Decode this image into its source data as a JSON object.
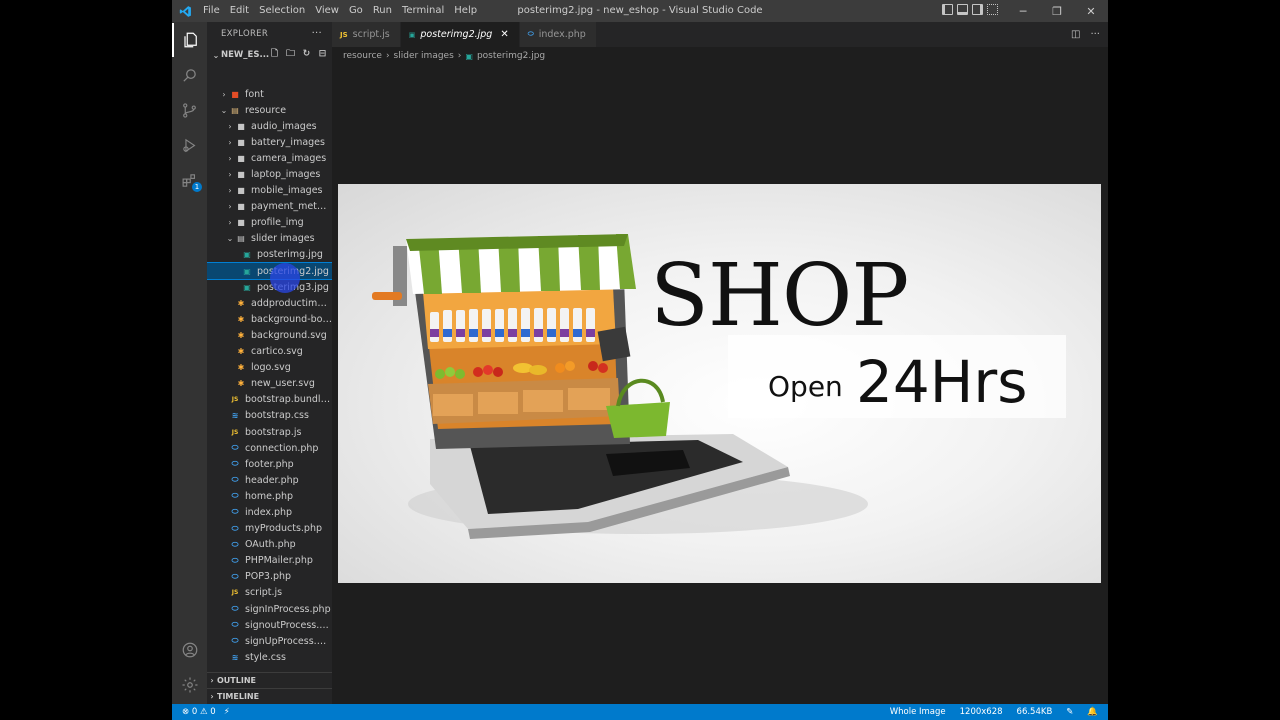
{
  "window": {
    "title": "posterimg2.jpg - new_eshop - Visual Studio Code",
    "menu": [
      "File",
      "Edit",
      "Selection",
      "View",
      "Go",
      "Run",
      "Terminal",
      "Help"
    ],
    "controls": [
      "─",
      "❐",
      "✕"
    ]
  },
  "activity": {
    "extensions_badge": "1"
  },
  "sidebar": {
    "title": "EXPLORER",
    "more": "···",
    "project": "NEW_ES...",
    "tree": [
      {
        "label": "font",
        "type": "folder",
        "depth": 1,
        "open": false,
        "icon_color": "#e44d26"
      },
      {
        "label": "resource",
        "type": "folder",
        "depth": 1,
        "open": true,
        "icon_color": "#dcb67a"
      },
      {
        "label": "audio_images",
        "type": "folder",
        "depth": 2,
        "open": false,
        "icon_color": "#c5c5c5"
      },
      {
        "label": "battery_images",
        "type": "folder",
        "depth": 2,
        "open": false,
        "icon_color": "#c5c5c5"
      },
      {
        "label": "camera_images",
        "type": "folder",
        "depth": 2,
        "open": false,
        "icon_color": "#c5c5c5"
      },
      {
        "label": "laptop_images",
        "type": "folder",
        "depth": 2,
        "open": false,
        "icon_color": "#c5c5c5"
      },
      {
        "label": "mobile_images",
        "type": "folder",
        "depth": 2,
        "open": false,
        "icon_color": "#c5c5c5"
      },
      {
        "label": "payment_method",
        "type": "folder",
        "depth": 2,
        "open": false,
        "icon_color": "#c5c5c5"
      },
      {
        "label": "profile_img",
        "type": "folder",
        "depth": 2,
        "open": false,
        "icon_color": "#c5c5c5"
      },
      {
        "label": "slider images",
        "type": "folder",
        "depth": 2,
        "open": true,
        "icon_color": "#c5c5c5"
      },
      {
        "label": "posterimg.jpg",
        "type": "image",
        "depth": 3,
        "icon_color": "#26a69a"
      },
      {
        "label": "posterimg2.jpg",
        "type": "image",
        "depth": 3,
        "selected": true,
        "icon_color": "#26a69a"
      },
      {
        "label": "posterimg3.jpg",
        "type": "image",
        "depth": 3,
        "icon_color": "#26a69a"
      },
      {
        "label": "addproductimg....",
        "type": "svg",
        "depth": 2,
        "icon_color": "#ffb13b"
      },
      {
        "label": "background-bod...",
        "type": "svg",
        "depth": 2,
        "icon_color": "#ffb13b"
      },
      {
        "label": "background.svg",
        "type": "svg",
        "depth": 2,
        "icon_color": "#ffb13b"
      },
      {
        "label": "cartico.svg",
        "type": "svg",
        "depth": 2,
        "icon_color": "#ffb13b"
      },
      {
        "label": "logo.svg",
        "type": "svg",
        "depth": 2,
        "icon_color": "#ffb13b"
      },
      {
        "label": "new_user.svg",
        "type": "svg",
        "depth": 2,
        "icon_color": "#ffb13b"
      },
      {
        "label": "bootstrap.bundle.js",
        "type": "js",
        "depth": 1,
        "icon_color": "#f1c232"
      },
      {
        "label": "bootstrap.css",
        "type": "css",
        "depth": 1,
        "icon_color": "#42a5f5"
      },
      {
        "label": "bootstrap.js",
        "type": "js",
        "depth": 1,
        "icon_color": "#f1c232"
      },
      {
        "label": "connection.php",
        "type": "php",
        "depth": 1,
        "icon_color": "#42a5f5"
      },
      {
        "label": "footer.php",
        "type": "php",
        "depth": 1,
        "icon_color": "#42a5f5"
      },
      {
        "label": "header.php",
        "type": "php",
        "depth": 1,
        "icon_color": "#42a5f5"
      },
      {
        "label": "home.php",
        "type": "php",
        "depth": 1,
        "icon_color": "#42a5f5"
      },
      {
        "label": "index.php",
        "type": "php",
        "depth": 1,
        "icon_color": "#42a5f5"
      },
      {
        "label": "myProducts.php",
        "type": "php",
        "depth": 1,
        "icon_color": "#42a5f5"
      },
      {
        "label": "OAuth.php",
        "type": "php",
        "depth": 1,
        "icon_color": "#42a5f5"
      },
      {
        "label": "PHPMailer.php",
        "type": "php",
        "depth": 1,
        "icon_color": "#42a5f5"
      },
      {
        "label": "POP3.php",
        "type": "php",
        "depth": 1,
        "icon_color": "#42a5f5"
      },
      {
        "label": "script.js",
        "type": "js",
        "depth": 1,
        "icon_color": "#f1c232"
      },
      {
        "label": "signInProcess.php",
        "type": "php",
        "depth": 1,
        "icon_color": "#42a5f5"
      },
      {
        "label": "signoutProcess.php",
        "type": "php",
        "depth": 1,
        "icon_color": "#42a5f5"
      },
      {
        "label": "signUpProcess.php",
        "type": "php",
        "depth": 1,
        "icon_color": "#42a5f5"
      },
      {
        "label": "style.css",
        "type": "css",
        "depth": 1,
        "icon_color": "#42a5f5"
      }
    ],
    "outline": "OUTLINE",
    "timeline": "TIMELINE"
  },
  "tabs": [
    {
      "label": "script.js",
      "icon": "JS",
      "icon_color": "#f1c232",
      "active": false
    },
    {
      "label": "posterimg2.jpg",
      "icon": "▣",
      "icon_color": "#26a69a",
      "active": true,
      "close": "✕"
    },
    {
      "label": "index.php",
      "icon": "⬭",
      "icon_color": "#42a5f5",
      "active": false
    }
  ],
  "breadcrumb": [
    "resource",
    "slider images",
    "posterimg2.jpg"
  ],
  "poster": {
    "headline": "SHOP",
    "open": "Open",
    "hours": "24Hrs"
  },
  "status": {
    "errors": "0",
    "warnings": "0",
    "zoom": "Whole Image",
    "dimensions": "1200x628",
    "size": "66.54KB"
  }
}
